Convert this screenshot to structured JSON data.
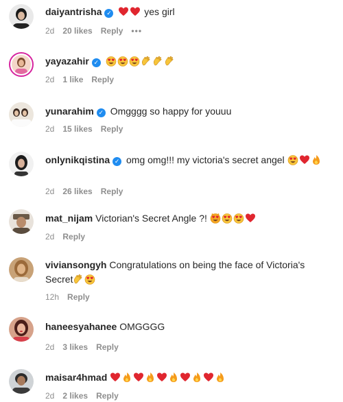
{
  "comments": [
    {
      "username": "daiyantrisha",
      "verified": true,
      "text": "yes girl",
      "emojis": [
        "heart",
        "heart"
      ],
      "emojis_trailing": [],
      "time": "2d",
      "likes": "20 likes",
      "reply": "Reply",
      "more": "•••"
    },
    {
      "username": "yayazahir",
      "verified": true,
      "text": "",
      "emojis": [
        "heart-eyes",
        "heart-eyes",
        "heart-eyes",
        "clap",
        "clap",
        "clap"
      ],
      "emojis_trailing": [],
      "time": "2d",
      "likes": "1 like",
      "reply": "Reply"
    },
    {
      "username": "yunarahim",
      "verified": true,
      "text": "Omgggg so happy for youuu",
      "emojis": [],
      "emojis_trailing": [],
      "time": "2d",
      "likes": "15 likes",
      "reply": "Reply"
    },
    {
      "username": "onlynikqistina",
      "verified": true,
      "text": "omg omg!!! my victoria's secret angel",
      "emojis": [],
      "emojis_trailing": [
        "heart-eyes",
        "heart",
        "fire"
      ],
      "time": "2d",
      "likes": "26 likes",
      "reply": "Reply"
    },
    {
      "username": "mat_nijam",
      "verified": false,
      "text": "Victorian's Secret Angle ?!",
      "emojis": [],
      "emojis_trailing": [
        "heart-eyes-cat",
        "heart-eyes",
        "heart-eyes",
        "heart"
      ],
      "time": "2d",
      "likes": "",
      "reply": "Reply"
    },
    {
      "username": "viviansongyh",
      "verified": false,
      "text": "Congratulations on being the face of Victoria's Secret",
      "emojis": [],
      "emojis_trailing": [
        "clap",
        "heart-eyes"
      ],
      "time": "12h",
      "likes": "",
      "reply": "Reply"
    },
    {
      "username": "haneesyahanee",
      "verified": false,
      "text": "OMGGGG",
      "emojis": [],
      "emojis_trailing": [],
      "time": "2d",
      "likes": "3 likes",
      "reply": "Reply"
    },
    {
      "username": "maisar4hmad",
      "verified": false,
      "text": "",
      "emojis": [
        "heart",
        "fire",
        "heart",
        "fire",
        "heart",
        "fire",
        "heart",
        "fire",
        "heart",
        "fire"
      ],
      "emojis_trailing": [],
      "time": "2d",
      "likes": "2 likes",
      "reply": "Reply"
    }
  ],
  "colors": {
    "text": "#262626",
    "meta": "#8e8e8e",
    "verified": "#1f8cf0",
    "heart": "#e0262f",
    "fire": "#f59b1b",
    "face": "#f7c53b"
  }
}
